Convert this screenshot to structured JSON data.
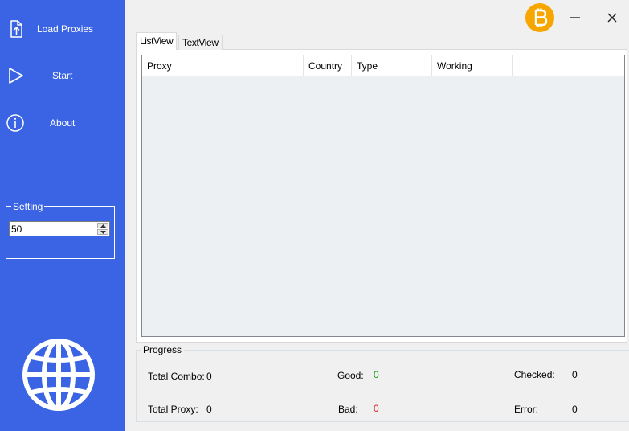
{
  "sidebar": {
    "load_proxies": "Load Proxies",
    "start": "Start",
    "about": "About",
    "setting_label": "Setting",
    "setting_value": "50"
  },
  "tabs": [
    {
      "label": "ListView",
      "active": true
    },
    {
      "label": "TextView",
      "active": false
    }
  ],
  "list": {
    "columns": [
      "Proxy",
      "Country",
      "Type",
      "Working",
      ""
    ]
  },
  "progress": {
    "title": "Progress",
    "total_combo_label": "Total Combo:",
    "total_combo_value": "0",
    "total_proxy_label": "Total Proxy:",
    "total_proxy_value": "0",
    "good_label": "Good:",
    "good_value": "0",
    "bad_label": "Bad:",
    "bad_value": "0",
    "checked_label": "Checked:",
    "checked_value": "0",
    "error_label": "Error:",
    "error_value": "0"
  },
  "colors": {
    "sidebar": "#3a64e4",
    "good": "#1a9a1a",
    "bad": "#e02020",
    "bitcoin": "#f7a600"
  },
  "icons": [
    "upload-file-icon",
    "play-icon",
    "info-icon",
    "globe-icon",
    "bitcoin-icon",
    "minimize-icon",
    "close-icon"
  ]
}
